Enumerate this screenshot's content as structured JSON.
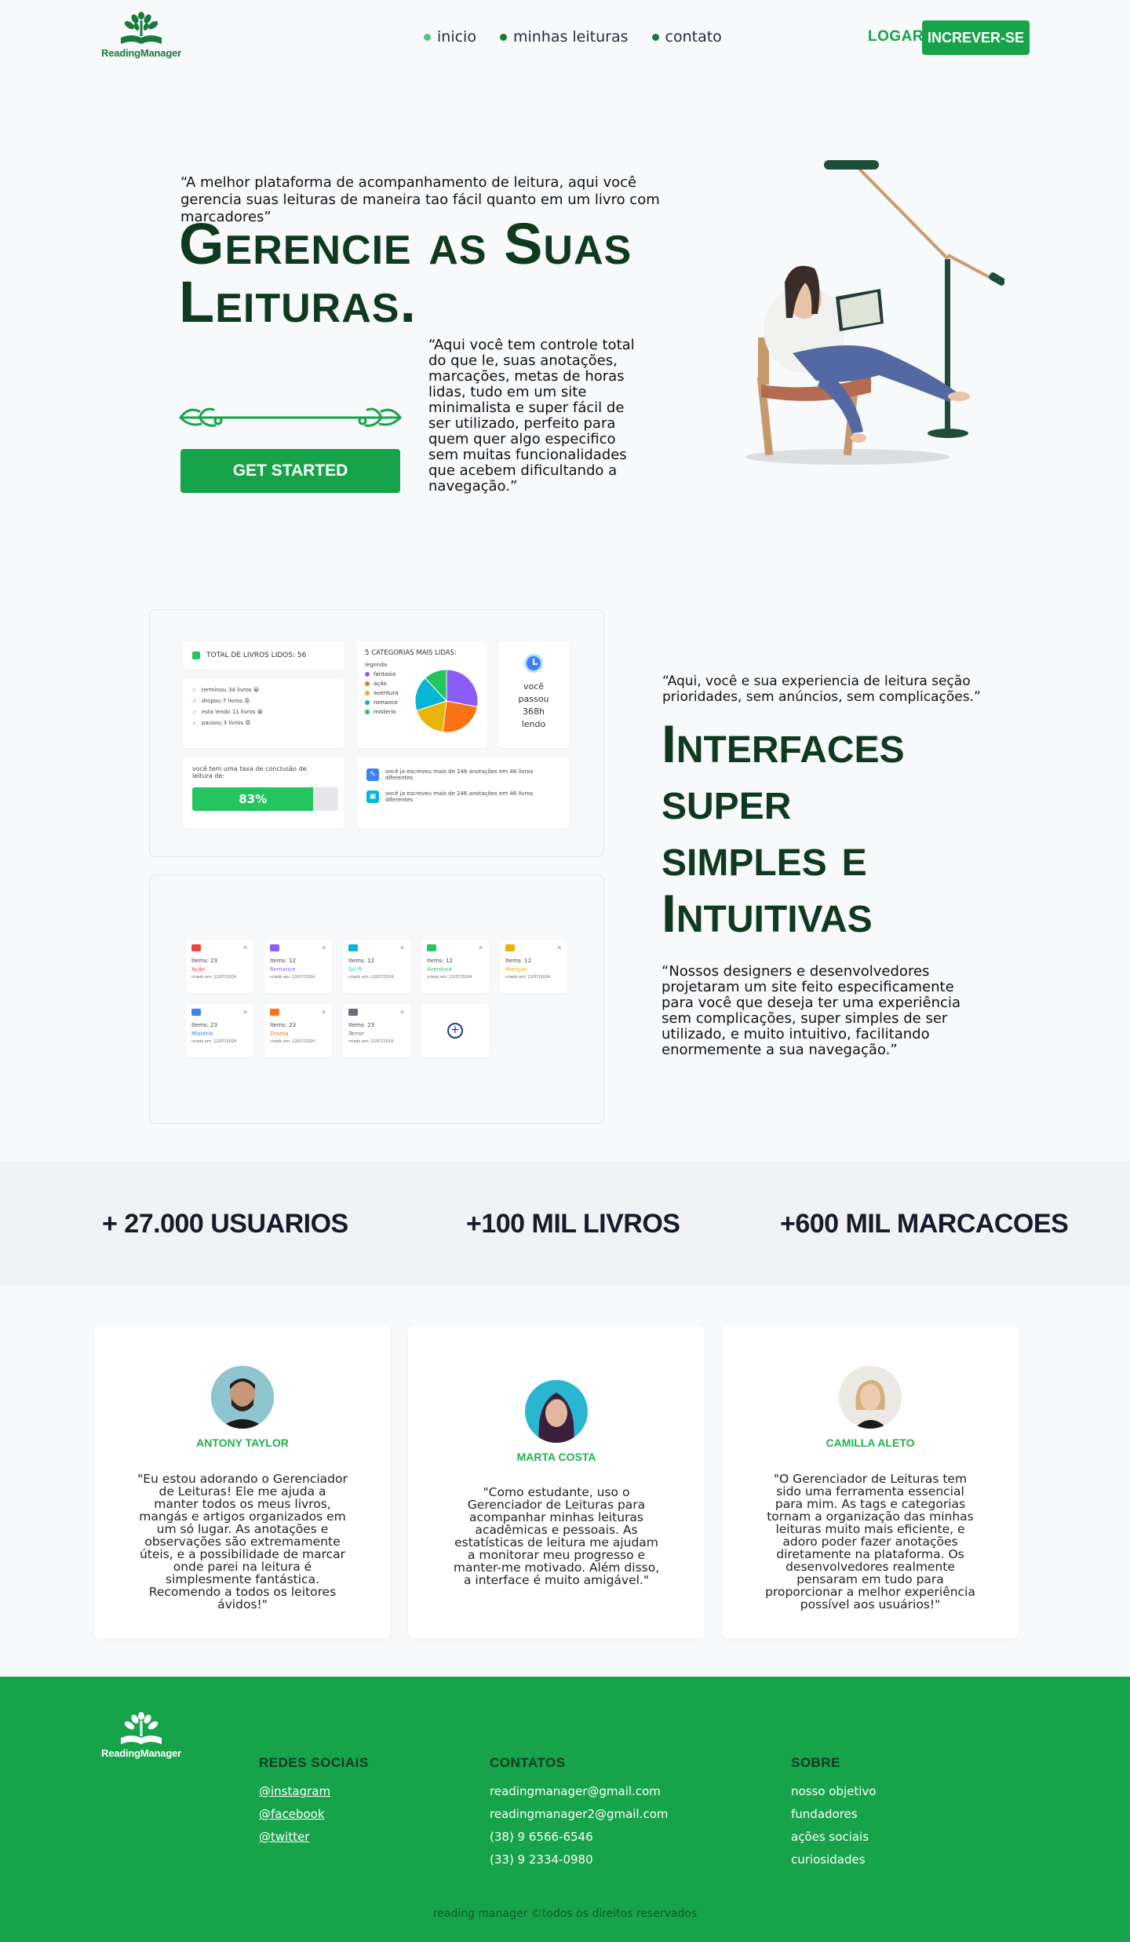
{
  "brand": {
    "name": "ReadingManager",
    "accent": "#17a34a",
    "dark_green": "#0f3a1f"
  },
  "nav": {
    "items": [
      {
        "label": "inicio"
      },
      {
        "label": "minhas leituras"
      },
      {
        "label": "contato"
      }
    ],
    "login_label": "LOGAR",
    "signup_label": "INCREVER-SE"
  },
  "hero": {
    "quote": "“A melhor plataforma de acompanhamento de leitura, aqui você gerencia suas leituras de maneira tao fácil  quanto em um livro com marcadores”",
    "title_line1": "Gerencie as Suas",
    "title_line2": "Leituras.",
    "description": "“Aqui você tem controle total do que le, suas anotações, marcações, metas de horas lidas, tudo em um site minimalista e super fácil de ser utilizado, perfeito para quem quer algo especifico sem muitas funcionalidades que acebem dificultando a navegação.”",
    "cta_label": "GET STARTED"
  },
  "dashboard": {
    "total_books": "TOTAL DE LIVROS LIDOS: 56",
    "statuses": [
      {
        "text": "terminou 34 livros 😀",
        "color": "#22c55e"
      },
      {
        "text": "dropou 7 livros 😡",
        "color": "#ef4444"
      },
      {
        "text": "esta lendo 11 livros 😀",
        "color": "#06b6d4"
      },
      {
        "text": "pausou 3 livros 😡",
        "color": "#8b5cf6"
      }
    ],
    "categories_title": "5 CATEGORIAS MAIS LIDAS:",
    "legend_title": "legenda",
    "categories": [
      {
        "name": "fantasia",
        "value": 28,
        "color": "#8b5cf6"
      },
      {
        "name": "ação",
        "value": 24,
        "color": "#f97316"
      },
      {
        "name": "aventura",
        "value": 18,
        "color": "#eab308"
      },
      {
        "name": "romance",
        "value": 18,
        "color": "#06b6d4"
      },
      {
        "name": "misterio",
        "value": 12,
        "color": "#22c55e"
      }
    ],
    "time_line1": "você",
    "time_line2": "passou",
    "time_line3": "368h",
    "time_line4": "lendo",
    "completion_label": "você tem uma taxa de conclusão de leitura de:",
    "completion_value": "83%",
    "completion_fraction": 0.83,
    "notes": [
      "você ja escreveu mais de 246 anotações em 46 livros diferentes",
      "você ja escreveu mais de 246 anotações em 46 livros diferentes"
    ],
    "folders": [
      {
        "items": "Items: 23",
        "genre": "Ação",
        "color": "#ef4444",
        "date": "criado em: 12/07/2024"
      },
      {
        "items": "Items: 12",
        "genre": "Romance",
        "color": "#8b5cf6",
        "date": "criado em: 12/07/2024"
      },
      {
        "items": "Items: 12",
        "genre": "Sci fi",
        "color": "#06b6d4",
        "date": "criado em: 12/07/2024"
      },
      {
        "items": "Items: 12",
        "genre": "Aventura",
        "color": "#22c55e",
        "date": "criado em: 12/07/2024"
      },
      {
        "items": "Items: 12",
        "genre": "Mangás",
        "color": "#eab308",
        "date": "criado em: 12/07/2024"
      },
      {
        "items": "Items: 23",
        "genre": "Mistério",
        "color": "#3b82f6",
        "date": "criado em: 12/07/2024"
      },
      {
        "items": "Items: 23",
        "genre": "Drama",
        "color": "#f97316",
        "date": "criado em: 12/07/2024"
      },
      {
        "items": "Items: 23",
        "genre": "Terror",
        "color": "#6b6b7b",
        "date": "criado em: 12/07/2024"
      }
    ]
  },
  "interfaces": {
    "quote": "“Aqui, você e sua experiencia de leitura seção prioridades, sem anúncios, sem complicações.”",
    "title_line1": "Interfaces",
    "title_line2": "super",
    "title_line3": "simples e",
    "title_line4": "Intuitivas",
    "description": "“Nossos designers e desenvolvedores projetaram um site feito especificamente para você que deseja ter uma experiência sem complicações, super simples de  ser utilizado, e muito intuitivo, facilitando enormemente a sua navegação.”"
  },
  "stats": {
    "users": "+ 27.000 USUARIOS",
    "books": "+100 MIL LIVROS",
    "marks": "+600 MIL MARCACOES"
  },
  "testimonials": [
    {
      "name": "ANTONY TAYLOR",
      "text": "\"Eu estou adorando o Gerenciador de Leituras! Ele me ajuda a manter todos os meus livros, mangás e artigos organizados em um só lugar. As anotações e observações são extremamente úteis, e a possibilidade de marcar onde parei na leitura é simplesmente fantástica. Recomendo a todos os leitores ávidos!\""
    },
    {
      "name": "MARTA COSTA",
      "text": "\"Como estudante, uso o Gerenciador de Leituras para acompanhar minhas leituras acadêmicas e pessoais. As estatísticas de leitura me ajudam a monitorar meu progresso e manter-me motivado. Além disso, a interface é muito amigável.\""
    },
    {
      "name": "CAMILLA ALETO",
      "text": "\"O Gerenciador de Leituras tem sido uma ferramenta essencial para mim. As tags e categorias tornam a organização das minhas leituras muito mais eficiente, e adoro poder fazer anotações diretamente na plataforma. Os desenvolvedores realmente pensaram em tudo para proporcionar a melhor experiência possível aos usuários!\""
    }
  ],
  "footer": {
    "social_title": "REDES SOCIAIS",
    "social": [
      "@instagram",
      "@facebook",
      "@twitter"
    ],
    "contacts_title": "CONTATOS",
    "contacts": [
      "readingmanager@gmail.com",
      "readingmanager2@gmail.com",
      "(38) 9 6566-6546",
      "(33) 9 2334-0980"
    ],
    "about_title": "SOBRE",
    "about": [
      "nosso objetivo",
      "fundadores",
      "ações sociais",
      "curiosidades"
    ],
    "copyright": "reading manager ©todos os direitos reservados"
  }
}
